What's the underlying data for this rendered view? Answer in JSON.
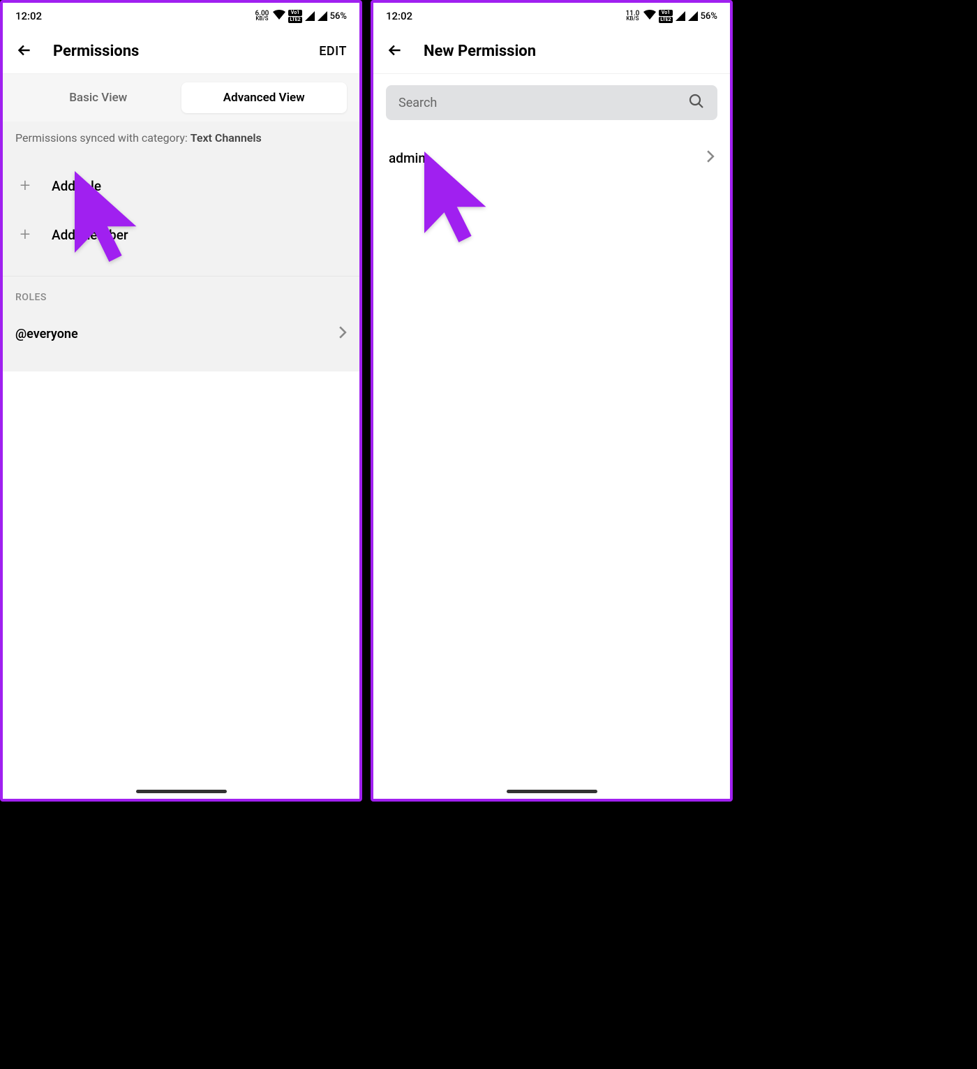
{
  "statusBar": {
    "time": "12:02",
    "battery": "56%",
    "speed1": "6.00",
    "speed2": "11.0",
    "speedUnit": "KB/S",
    "lte1": "Vo1",
    "lte2": "LTE2"
  },
  "left": {
    "header": {
      "title": "Permissions",
      "action": "EDIT"
    },
    "tabs": {
      "basic": "Basic View",
      "advanced": "Advanced View"
    },
    "syncPrefix": "Permissions synced with category: ",
    "syncCategory": "Text Channels",
    "addRole": "Add role",
    "addMember": "Add member",
    "rolesHeader": "ROLES",
    "roleItem": "@everyone"
  },
  "right": {
    "header": {
      "title": "New Permission"
    },
    "search": {
      "placeholder": "Search"
    },
    "result": "admin"
  }
}
